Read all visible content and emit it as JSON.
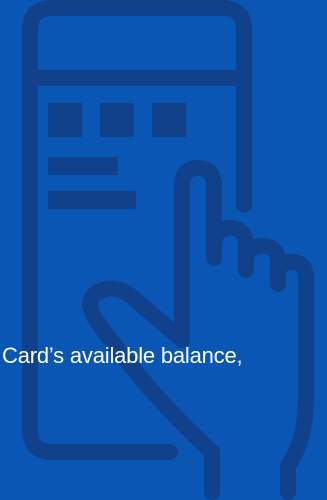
{
  "banner": {
    "caption": "Card’s available balance,",
    "icon": "phone-with-tapping-hand-icon"
  },
  "colors": {
    "background": "#0a56b5",
    "illustration": "#11418a",
    "text": "#ffffff"
  }
}
